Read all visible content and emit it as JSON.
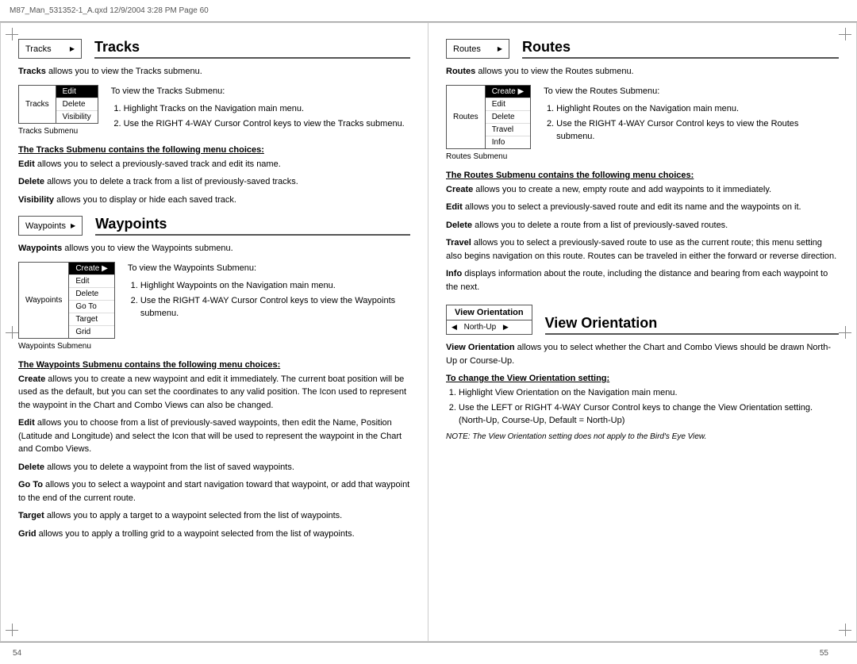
{
  "header": {
    "text": "M87_Man_531352-1_A.qxd   12/9/2004   3:28 PM   Page 60"
  },
  "footer": {
    "left_page": "54",
    "right_page": "55"
  },
  "left_page": {
    "sections": [
      {
        "id": "tracks",
        "box_label": "Tracks",
        "box_arrow": "▶",
        "title": "Tracks",
        "intro": "Tracks allows you to view the Tracks submenu.",
        "submenu_label": "Tracks",
        "submenu_items": [
          "Edit",
          "Delete",
          "Visibility"
        ],
        "submenu_caption": "Tracks Submenu",
        "to_view_label": "To view the Tracks Submenu:",
        "steps": [
          "Highlight Tracks on the Navigation main menu.",
          "Use the RIGHT 4-WAY Cursor Control keys to view the Tracks submenu."
        ],
        "submenu_contains_heading": "The Tracks Submenu contains the following menu choices:",
        "menu_items": [
          {
            "term": "Edit",
            "desc": "allows you to select a previously-saved track and edit its name."
          },
          {
            "term": "Delete",
            "desc": "allows you to delete a track from a list of previously-saved tracks."
          },
          {
            "term": "Visibility",
            "desc": "allows you to display or hide each saved track."
          }
        ]
      },
      {
        "id": "waypoints",
        "box_label": "Waypoints",
        "box_arrow": "▶",
        "title": "Waypoints",
        "intro": "Waypoints allows you to view the Waypoints submenu.",
        "submenu_label": "Waypoints",
        "submenu_items": [
          "Create ▶",
          "Edit",
          "Delete",
          "Go To",
          "Target",
          "Grid"
        ],
        "submenu_caption": "Waypoints Submenu",
        "to_view_label": "To view the Waypoints Submenu:",
        "steps": [
          "Highlight Waypoints on the Navigation main menu.",
          "Use the RIGHT 4-WAY Cursor Control keys to view the Waypoints submenu."
        ],
        "submenu_contains_heading": "The Waypoints Submenu contains the following menu choices:",
        "menu_items": [
          {
            "term": "Create",
            "desc": "allows you to create a new waypoint and edit it immediately. The current boat position will be used as the default, but you can set the coordinates to any valid position. The Icon used to represent the waypoint in the Chart and Combo Views can also be changed."
          },
          {
            "term": "Edit",
            "desc": "allows you to choose from a list of previously-saved waypoints, then edit the Name, Position (Latitude and Longitude) and select the Icon that will be used to represent the waypoint in the Chart and Combo Views."
          },
          {
            "term": "Delete",
            "desc": "allows you to delete a waypoint from the list of saved waypoints."
          },
          {
            "term": "Go To",
            "desc": "allows you to select a waypoint and start navigation toward that waypoint, or add that waypoint to the end of the current route."
          },
          {
            "term": "Target",
            "desc": "allows you to apply a target to a waypoint selected from the list of waypoints."
          },
          {
            "term": "Grid",
            "desc": "allows you to apply a trolling grid to a waypoint selected from the list of waypoints."
          }
        ]
      }
    ]
  },
  "right_page": {
    "sections": [
      {
        "id": "routes",
        "box_label": "Routes",
        "box_arrow": "▶",
        "title": "Routes",
        "intro": "Routes allows you to view the Routes submenu.",
        "submenu_label": "Routes",
        "submenu_items": [
          "Create ▶",
          "Edit",
          "Delete",
          "Travel",
          "Info"
        ],
        "submenu_caption": "Routes Submenu",
        "to_view_label": "To view the Routes Submenu:",
        "steps": [
          "Highlight Routes on the Navigation main menu.",
          "Use the RIGHT 4-WAY Cursor Control keys to view the Routes submenu."
        ],
        "submenu_contains_heading": "The Routes Submenu contains the following menu choices:",
        "menu_items": [
          {
            "term": "Create",
            "desc": "allows you to create a new, empty route and add waypoints to it immediately."
          },
          {
            "term": "Edit",
            "desc": "allows you to select a previously-saved route and edit its name and the waypoints on it."
          },
          {
            "term": "Delete",
            "desc": "allows you to delete a route from a list of previously-saved routes."
          },
          {
            "term": "Travel",
            "desc": "allows you to select a previously-saved route to use as the current route; this menu setting also begins navigation on this route. Routes can be traveled in either the forward or reverse direction."
          },
          {
            "term": "Info",
            "desc": "displays information about the route, including the distance and bearing from each waypoint to the next."
          }
        ]
      },
      {
        "id": "view-orientation",
        "box_title": "View Orientation",
        "box_value": "North-Up",
        "title": "View Orientation",
        "intro_bold": "View Orientation",
        "intro": " allows you to select whether the Chart and Combo Views should be drawn North-Up or Course-Up.",
        "change_heading": "To change the View Orientation setting:",
        "steps": [
          "Highlight View Orientation on the Navigation main menu.",
          "Use the LEFT or RIGHT 4-WAY Cursor Control keys to change the View Orientation setting. (North-Up, Course-Up, Default = North-Up)"
        ],
        "note": "NOTE:  The View Orientation setting does not apply to the Bird's Eye View."
      }
    ]
  }
}
